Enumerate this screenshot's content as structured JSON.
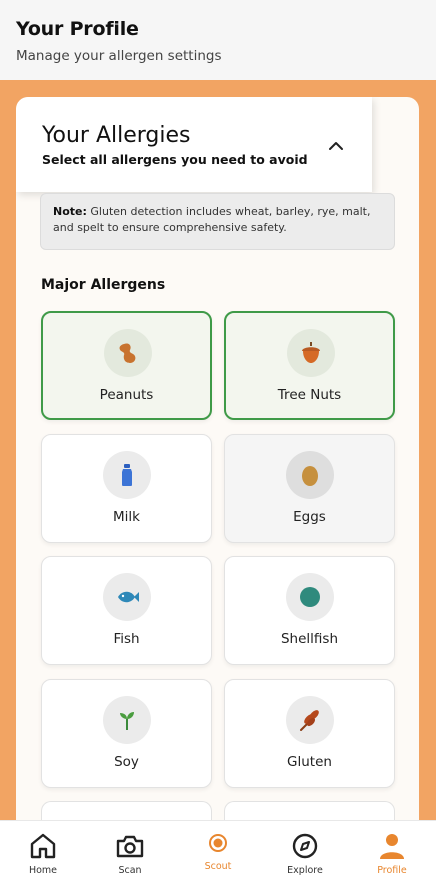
{
  "header": {
    "title": "Your Profile",
    "subtitle": "Manage your allergen settings"
  },
  "allergies": {
    "title": "Your Allergies",
    "subtitle": "Select all allergens you need to avoid",
    "note_label": "Note:",
    "note_text": " Gluten detection includes wheat, barley, rye, malt, and spelt to ensure comprehensive safety.",
    "section_title": "Major Allergens",
    "items": [
      {
        "label": "Peanuts",
        "icon": "peanut-icon",
        "selected": true
      },
      {
        "label": "Tree Nuts",
        "icon": "acorn-icon",
        "selected": true
      },
      {
        "label": "Milk",
        "icon": "milk-bottle-icon",
        "selected": false
      },
      {
        "label": "Eggs",
        "icon": "egg-icon",
        "selected": false
      },
      {
        "label": "Fish",
        "icon": "fish-icon",
        "selected": false
      },
      {
        "label": "Shellfish",
        "icon": "shellfish-icon",
        "selected": false
      },
      {
        "label": "Soy",
        "icon": "sprout-icon",
        "selected": false
      },
      {
        "label": "Gluten",
        "icon": "wheat-icon",
        "selected": false
      }
    ]
  },
  "colors": {
    "accent": "#e8862e",
    "selected_border": "#3f9a48",
    "background": "#f2a463"
  },
  "nav": {
    "items": [
      {
        "label": "Home",
        "icon": "home-icon"
      },
      {
        "label": "Scan",
        "icon": "camera-icon"
      },
      {
        "label": "Scout",
        "icon": "chat-bubble-icon"
      },
      {
        "label": "Explore",
        "icon": "compass-icon"
      },
      {
        "label": "Profile",
        "icon": "person-icon",
        "active": true
      }
    ]
  }
}
